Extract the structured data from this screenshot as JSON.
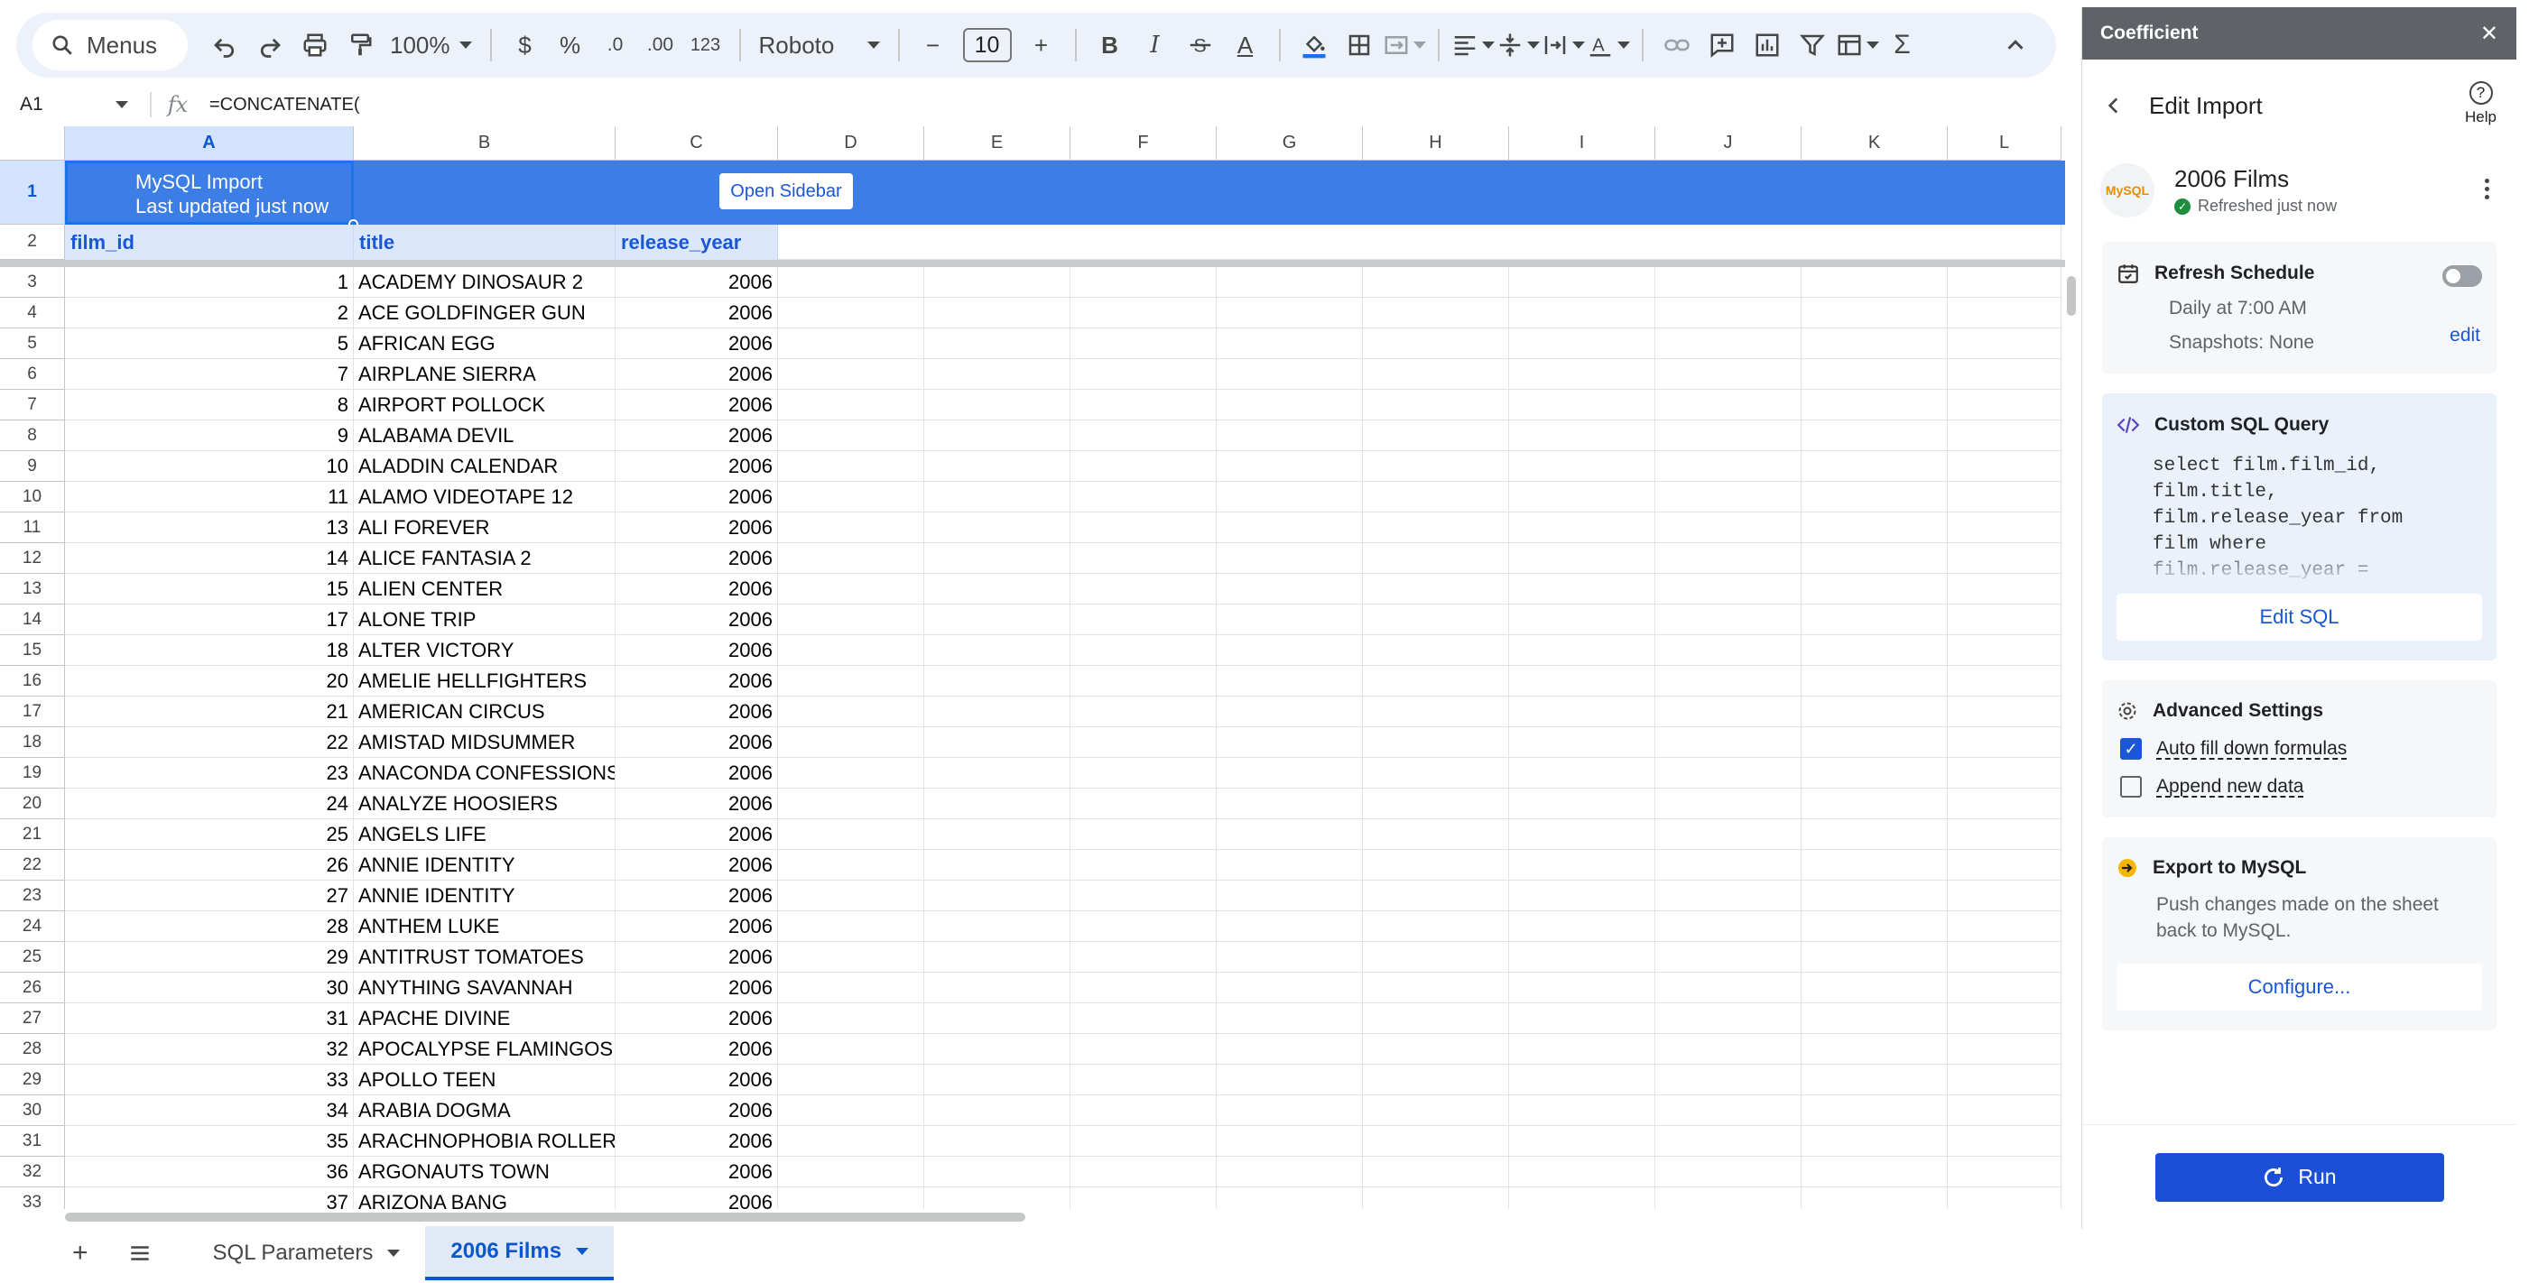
{
  "toolbar": {
    "menus_label": "Menus",
    "zoom": "100%",
    "currency": "$",
    "percent": "%",
    "dec_decrease": ".0",
    "dec_increase": ".00",
    "more_formats": "123",
    "font": "Roboto",
    "font_size": "10",
    "minus": "−",
    "plus": "+",
    "bold": "B",
    "italic": "I",
    "text_color": "A"
  },
  "formula_bar": {
    "cell_ref": "A1",
    "fx": "fx",
    "formula": "=CONCATENATE("
  },
  "grid": {
    "columns": [
      "A",
      "B",
      "C",
      "D",
      "E",
      "F",
      "G",
      "H",
      "I",
      "J",
      "K",
      "L"
    ],
    "banner_line1": "MySQL Import",
    "banner_line2": "Last updated just now",
    "open_sidebar": "Open Sidebar",
    "headers": [
      "film_id",
      "title",
      "release_year"
    ],
    "rows": [
      {
        "n": "3",
        "id": "1",
        "title": "ACADEMY DINOSAUR 2",
        "year": "2006"
      },
      {
        "n": "4",
        "id": "2",
        "title": "ACE GOLDFINGER GUN",
        "year": "2006"
      },
      {
        "n": "5",
        "id": "5",
        "title": "AFRICAN EGG",
        "year": "2006"
      },
      {
        "n": "6",
        "id": "7",
        "title": "AIRPLANE SIERRA",
        "year": "2006"
      },
      {
        "n": "7",
        "id": "8",
        "title": "AIRPORT POLLOCK",
        "year": "2006"
      },
      {
        "n": "8",
        "id": "9",
        "title": "ALABAMA DEVIL",
        "year": "2006"
      },
      {
        "n": "9",
        "id": "10",
        "title": "ALADDIN CALENDAR",
        "year": "2006"
      },
      {
        "n": "10",
        "id": "11",
        "title": "ALAMO VIDEOTAPE 12",
        "year": "2006"
      },
      {
        "n": "11",
        "id": "13",
        "title": "ALI FOREVER",
        "year": "2006"
      },
      {
        "n": "12",
        "id": "14",
        "title": "ALICE FANTASIA 2",
        "year": "2006"
      },
      {
        "n": "13",
        "id": "15",
        "title": "ALIEN CENTER",
        "year": "2006"
      },
      {
        "n": "14",
        "id": "17",
        "title": "ALONE TRIP",
        "year": "2006"
      },
      {
        "n": "15",
        "id": "18",
        "title": "ALTER VICTORY",
        "year": "2006"
      },
      {
        "n": "16",
        "id": "20",
        "title": "AMELIE HELLFIGHTERS",
        "year": "2006"
      },
      {
        "n": "17",
        "id": "21",
        "title": "AMERICAN CIRCUS",
        "year": "2006"
      },
      {
        "n": "18",
        "id": "22",
        "title": "AMISTAD MIDSUMMER",
        "year": "2006"
      },
      {
        "n": "19",
        "id": "23",
        "title": "ANACONDA CONFESSIONS",
        "year": "2006"
      },
      {
        "n": "20",
        "id": "24",
        "title": "ANALYZE HOOSIERS",
        "year": "2006"
      },
      {
        "n": "21",
        "id": "25",
        "title": "ANGELS LIFE",
        "year": "2006"
      },
      {
        "n": "22",
        "id": "26",
        "title": "ANNIE IDENTITY",
        "year": "2006"
      },
      {
        "n": "23",
        "id": "27",
        "title": "ANNIE IDENTITY",
        "year": "2006"
      },
      {
        "n": "24",
        "id": "28",
        "title": "ANTHEM LUKE",
        "year": "2006"
      },
      {
        "n": "25",
        "id": "29",
        "title": "ANTITRUST TOMATOES",
        "year": "2006"
      },
      {
        "n": "26",
        "id": "30",
        "title": "ANYTHING SAVANNAH",
        "year": "2006"
      },
      {
        "n": "27",
        "id": "31",
        "title": "APACHE DIVINE",
        "year": "2006"
      },
      {
        "n": "28",
        "id": "32",
        "title": "APOCALYPSE FLAMINGOS",
        "year": "2006"
      },
      {
        "n": "29",
        "id": "33",
        "title": "APOLLO TEEN",
        "year": "2006"
      },
      {
        "n": "30",
        "id": "34",
        "title": "ARABIA DOGMA",
        "year": "2006"
      },
      {
        "n": "31",
        "id": "35",
        "title": "ARACHNOPHOBIA ROLLERC",
        "year": "2006"
      },
      {
        "n": "32",
        "id": "36",
        "title": "ARGONAUTS TOWN",
        "year": "2006"
      },
      {
        "n": "33",
        "id": "37",
        "title": "ARIZONA BANG",
        "year": "2006"
      }
    ]
  },
  "tabs": [
    {
      "label": "SQL Parameters",
      "active": false
    },
    {
      "label": "2006 Films",
      "active": true
    }
  ],
  "sidebar": {
    "app_name": "Coefficient",
    "close": "✕",
    "title": "Edit Import",
    "help": "Help",
    "import_name": "2006 Films",
    "import_status": "Refreshed just now",
    "logo_text": "MySQL",
    "refresh": {
      "title": "Refresh Schedule",
      "schedule": "Daily at 7:00 AM",
      "snapshots": "Snapshots: None",
      "edit": "edit"
    },
    "sql": {
      "title": "Custom SQL Query",
      "query": "select film.film_id,\nfilm.title,\nfilm.release_year from\nfilm where\nfilm.release_year =",
      "button": "Edit SQL"
    },
    "advanced": {
      "title": "Advanced Settings",
      "auto_fill": "Auto fill down formulas",
      "append": "Append new data"
    },
    "export": {
      "title": "Export to MySQL",
      "desc": "Push changes made on the sheet back to MySQL.",
      "button": "Configure..."
    },
    "run": "Run"
  },
  "colors": {
    "banner": "#3d7de6",
    "accent": "#1a56d6"
  }
}
